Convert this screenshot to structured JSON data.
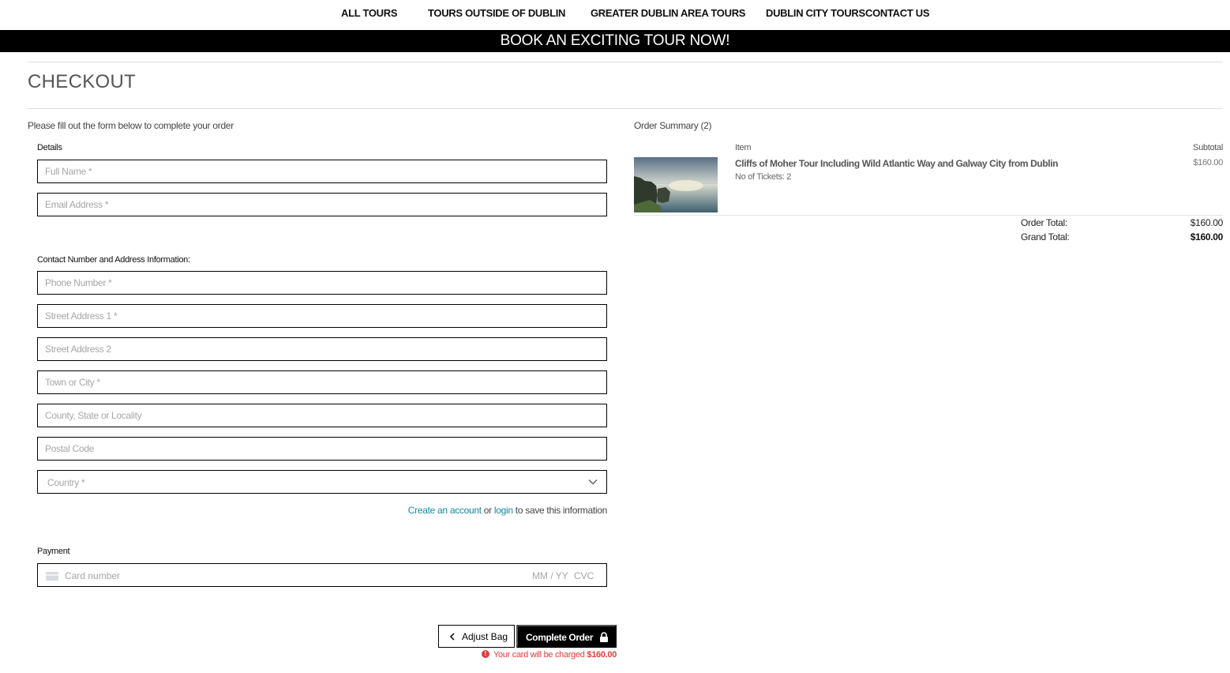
{
  "nav": {
    "items": [
      "ALL TOURS",
      "TOURS OUTSIDE OF DUBLIN",
      "GREATER DUBLIN AREA TOURS",
      "DUBLIN CITY TOURS",
      "CONTACT US"
    ]
  },
  "banner": {
    "text": "BOOK AN EXCITING TOUR NOW!"
  },
  "page": {
    "title": "CHECKOUT"
  },
  "form": {
    "intro": "Please fill out the form below to complete your order",
    "details_label": "Details",
    "full_name_placeholder": "Full Name *",
    "email_placeholder": "Email Address *",
    "contact_label": "Contact Number and Address Information:",
    "phone_placeholder": "Phone Number *",
    "street1_placeholder": "Street Address 1 *",
    "street2_placeholder": "Street Address 2",
    "town_placeholder": "Town or City *",
    "county_placeholder": "County, State or Locality",
    "postcode_placeholder": "Postal Code",
    "country_placeholder": "Country *",
    "account_create": "Create an account",
    "account_or": " or ",
    "account_login": "login",
    "account_suffix": " to save this information",
    "payment_label": "Payment",
    "card_number_placeholder": "Card number",
    "card_expiry_placeholder": "MM / YY",
    "card_cvc_placeholder": "CVC"
  },
  "actions": {
    "adjust_bag": "Adjust Bag",
    "complete_order": "Complete Order",
    "charge_notice": "Your card will be charged ",
    "charge_amount": "$160.00"
  },
  "summary": {
    "title": "Order Summary (2)",
    "col_item": "Item",
    "col_subtotal": "Subtotal",
    "item_name": "Cliffs of Moher Tour Including Wild Atlantic Way and Galway City from Dublin",
    "item_tickets": "No of Tickets: 2",
    "item_subtotal": "$160.00",
    "order_total_label": "Order Total:",
    "order_total_value": "$160.00",
    "grand_total_label": "Grand Total:",
    "grand_total_value": "$160.00"
  },
  "colors": {
    "accent_link": "#178a9a",
    "error": "#e03d3d",
    "banner_bg": "#000000"
  }
}
